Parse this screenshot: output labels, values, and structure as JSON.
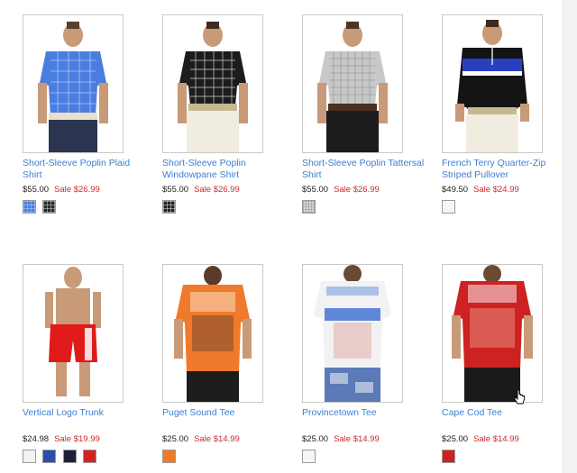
{
  "products": [
    {
      "name": "Short-Sleeve Poplin Plaid Shirt",
      "price": "$55.00",
      "sale": "Sale $26.99",
      "image": "man-in-blue-plaid-shirt",
      "swatches": [
        {
          "color": "#4a7de0",
          "icon": "plaid-swatch"
        },
        {
          "color": "#2a2a2a",
          "icon": "plaid-swatch"
        }
      ]
    },
    {
      "name": "Short-Sleeve Poplin Windowpane Shirt",
      "price": "$55.00",
      "sale": "Sale $26.99",
      "image": "man-in-black-windowpane-shirt",
      "swatches": [
        {
          "color": "#222222",
          "icon": "plaid-swatch"
        }
      ]
    },
    {
      "name": "Short-Sleeve Poplin Tattersal Shirt",
      "price": "$55.00",
      "sale": "Sale $26.99",
      "image": "man-in-gray-tattersal-shirt",
      "swatches": [
        {
          "color": "#c8c8c8",
          "icon": "plaid-swatch"
        }
      ]
    },
    {
      "name": "French Terry Quarter-Zip Striped Pullover",
      "price": "$49.50",
      "sale": "Sale $24.99",
      "image": "man-in-striped-pullover",
      "swatches": [
        {
          "color": "#f5f5f5",
          "icon": "solid-swatch"
        }
      ]
    },
    {
      "name": "Vertical Logo Trunk",
      "price": "$24.98",
      "sale": "Sale $19.99",
      "image": "man-in-red-swim-trunk",
      "swatches": [
        {
          "color": "#f2f2f2",
          "icon": "solid-swatch"
        },
        {
          "color": "#2a4fa8",
          "icon": "solid-swatch"
        },
        {
          "color": "#1c2235",
          "icon": "solid-swatch"
        },
        {
          "color": "#d22222",
          "icon": "solid-swatch"
        }
      ]
    },
    {
      "name": "Puget Sound Tee",
      "price": "$25.00",
      "sale": "Sale $14.99",
      "image": "man-in-orange-graphic-tee",
      "swatches": [
        {
          "color": "#f07a2c",
          "icon": "solid-swatch"
        }
      ]
    },
    {
      "name": "Provincetown Tee",
      "price": "$25.00",
      "sale": "Sale $14.99",
      "image": "man-in-white-graphic-tee",
      "swatches": [
        {
          "color": "#f6f6f6",
          "icon": "solid-swatch"
        }
      ]
    },
    {
      "name": "Cape Cod Tee",
      "price": "$25.00",
      "sale": "Sale $14.99",
      "image": "man-in-red-graphic-tee",
      "swatches": [
        {
          "color": "#cc2222",
          "icon": "solid-swatch"
        }
      ]
    }
  ],
  "colors": {
    "link": "#3c7fcf",
    "sale": "#cc2a2a",
    "border": "#c9c9c9"
  }
}
